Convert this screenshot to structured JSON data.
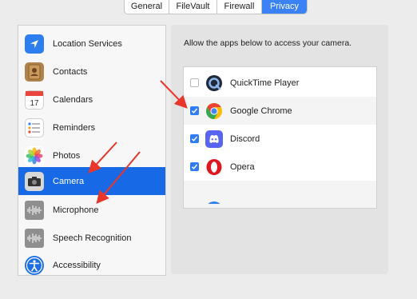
{
  "tabs": [
    {
      "label": "General",
      "active": false
    },
    {
      "label": "FileVault",
      "active": false
    },
    {
      "label": "Firewall",
      "active": false
    },
    {
      "label": "Privacy",
      "active": true
    }
  ],
  "sidebar": {
    "items": [
      {
        "label": "Location Services",
        "icon": "location-arrow-icon",
        "selected": false
      },
      {
        "label": "Contacts",
        "icon": "contacts-book-icon",
        "selected": false
      },
      {
        "label": "Calendars",
        "icon": "calendar-icon",
        "selected": false,
        "icon_text": "17"
      },
      {
        "label": "Reminders",
        "icon": "reminders-list-icon",
        "selected": false
      },
      {
        "label": "Photos",
        "icon": "photos-flower-icon",
        "selected": false
      },
      {
        "label": "Camera",
        "icon": "camera-icon",
        "selected": true
      },
      {
        "label": "Microphone",
        "icon": "microphone-waveform-icon",
        "selected": false
      },
      {
        "label": "Speech Recognition",
        "icon": "speech-waveform-icon",
        "selected": false
      },
      {
        "label": "Accessibility",
        "icon": "accessibility-person-icon",
        "selected": false
      }
    ]
  },
  "main": {
    "heading": "Allow the apps below to access your camera.",
    "apps": [
      {
        "label": "QuickTime Player",
        "checked": false,
        "icon": "quicktime-icon"
      },
      {
        "label": "Google Chrome",
        "checked": true,
        "icon": "chrome-icon"
      },
      {
        "label": "Discord",
        "checked": true,
        "icon": "discord-icon"
      },
      {
        "label": "Opera",
        "checked": true,
        "icon": "opera-icon"
      }
    ]
  },
  "colors": {
    "accent": "#1769e6",
    "checkbox": "#2f7cf6",
    "annotation_arrow": "#e8362a"
  }
}
